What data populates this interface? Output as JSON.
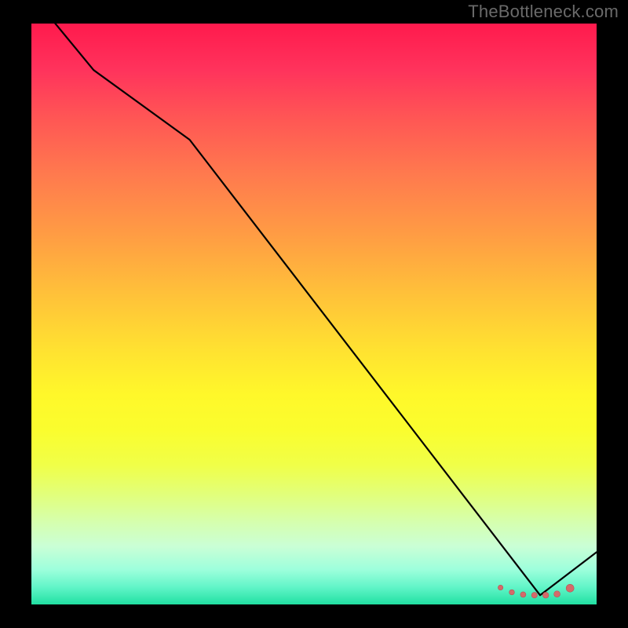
{
  "watermark": "TheBottleneck.com",
  "colors": {
    "background": "#000000",
    "gradient_top": "#ff1a4d",
    "gradient_mid": "#ffe131",
    "gradient_bottom": "#21e0a2",
    "line": "#000000",
    "marker_fill": "#d46a6a",
    "marker_stroke": "#b85454"
  },
  "chart_data": {
    "type": "line",
    "title": "",
    "xlabel": "",
    "ylabel": "",
    "xlim": [
      0,
      100
    ],
    "ylim": [
      0,
      100
    ],
    "grid": false,
    "legend": false,
    "series": [
      {
        "name": "curve",
        "x": [
          0,
          11,
          28,
          90,
          100
        ],
        "y": [
          105,
          92,
          80,
          1.6,
          9
        ]
      }
    ],
    "markers": {
      "name": "highlight-dots",
      "points": [
        {
          "x": 83.0,
          "y": 2.9
        },
        {
          "x": 85.0,
          "y": 2.1
        },
        {
          "x": 87.0,
          "y": 1.7
        },
        {
          "x": 89.0,
          "y": 1.6
        },
        {
          "x": 91.0,
          "y": 1.6
        },
        {
          "x": 93.0,
          "y": 1.8
        },
        {
          "x": 95.3,
          "y": 2.8
        }
      ],
      "radius_end": 5
    }
  }
}
